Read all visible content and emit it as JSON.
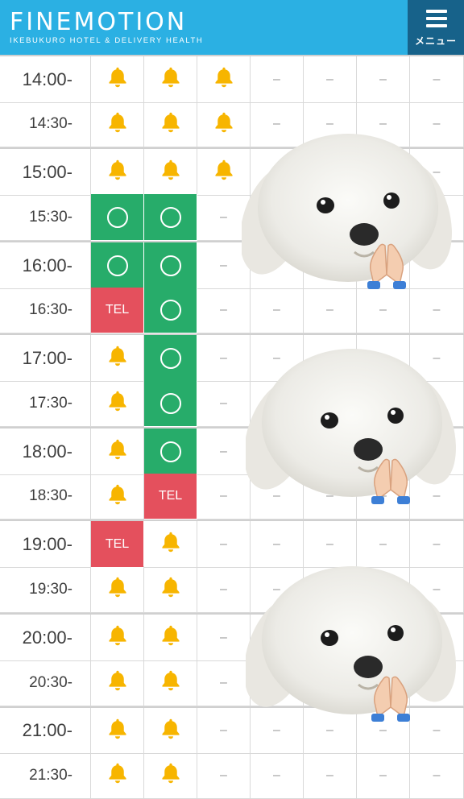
{
  "header": {
    "brand_title": "FINEMOTION",
    "brand_subtitle": "IKEBUKURO HOTEL & DELIVERY HEALTH",
    "menu_label": "メニュー",
    "menu_icon": "hamburger-icon",
    "bg_color": "#2bb0e3",
    "menu_bg_color": "#17628a"
  },
  "legend": {
    "bell": "bell-icon (call / waiting)",
    "circle": "available",
    "tel": "TEL",
    "dash": "–"
  },
  "colors": {
    "available": "#27ac6a",
    "tel": "#e4505d",
    "bell": "#f7b500"
  },
  "schedule": [
    {
      "time": "14:00-",
      "cells": [
        "bell",
        "bell",
        "bell",
        "dash",
        "dash",
        "dash",
        "dash"
      ]
    },
    {
      "time": "14:30-",
      "cells": [
        "bell",
        "bell",
        "bell",
        "dash",
        "dash",
        "dash",
        "dash"
      ]
    },
    {
      "time": "15:00-",
      "cells": [
        "bell",
        "bell",
        "bell",
        "dash",
        "dash",
        "dash",
        "dash"
      ]
    },
    {
      "time": "15:30-",
      "cells": [
        "circle",
        "circle",
        "dash",
        "dash",
        "dash",
        "dash",
        "dash"
      ]
    },
    {
      "time": "16:00-",
      "cells": [
        "circle",
        "circle",
        "dash",
        "dash",
        "dash",
        "dash",
        "dash"
      ]
    },
    {
      "time": "16:30-",
      "cells": [
        "tel",
        "circle",
        "dash",
        "dash",
        "dash",
        "dash",
        "dash"
      ]
    },
    {
      "time": "17:00-",
      "cells": [
        "bell",
        "circle",
        "dash",
        "dash",
        "dash",
        "dash",
        "dash"
      ]
    },
    {
      "time": "17:30-",
      "cells": [
        "bell",
        "circle",
        "dash",
        "dash",
        "dash",
        "dash",
        "dash"
      ]
    },
    {
      "time": "18:00-",
      "cells": [
        "bell",
        "circle",
        "dash",
        "dash",
        "dash",
        "dash",
        "dash"
      ]
    },
    {
      "time": "18:30-",
      "cells": [
        "bell",
        "tel",
        "dash",
        "dash",
        "dash",
        "dash",
        "dash"
      ]
    },
    {
      "time": "19:00-",
      "cells": [
        "tel",
        "bell",
        "dash",
        "dash",
        "dash",
        "dash",
        "dash"
      ]
    },
    {
      "time": "19:30-",
      "cells": [
        "bell",
        "bell",
        "dash",
        "dash",
        "dash",
        "dash",
        "dash"
      ]
    },
    {
      "time": "20:00-",
      "cells": [
        "bell",
        "bell",
        "dash",
        "dash",
        "dash",
        "dash",
        "dash"
      ]
    },
    {
      "time": "20:30-",
      "cells": [
        "bell",
        "bell",
        "dash",
        "dash",
        "dash",
        "dash",
        "dash"
      ]
    },
    {
      "time": "21:00-",
      "cells": [
        "bell",
        "bell",
        "dash",
        "dash",
        "dash",
        "dash",
        "dash"
      ]
    },
    {
      "time": "21:30-",
      "cells": [
        "bell",
        "bell",
        "dash",
        "dash",
        "dash",
        "dash",
        "dash"
      ]
    }
  ],
  "stickers": [
    {
      "name": "dog-sticker-1",
      "icon": "praying-hands-icon"
    },
    {
      "name": "dog-sticker-2",
      "icon": "praying-hands-icon"
    },
    {
      "name": "dog-sticker-3",
      "icon": "praying-hands-icon"
    }
  ]
}
